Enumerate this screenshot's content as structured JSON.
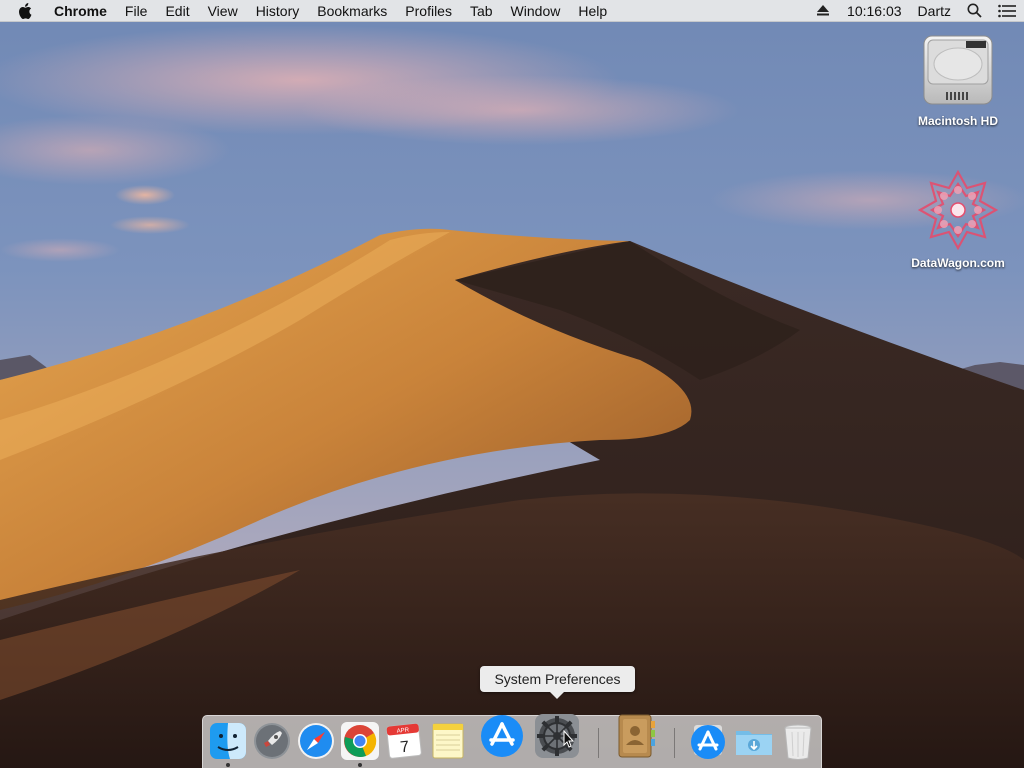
{
  "menubar": {
    "app_name": "Chrome",
    "items": [
      "File",
      "Edit",
      "View",
      "History",
      "Bookmarks",
      "Profiles",
      "Tab",
      "Window",
      "Help"
    ],
    "clock": "10:16:03",
    "user": "Dartz"
  },
  "desktop": {
    "icons": [
      {
        "label": "Macintosh HD",
        "icon": "hard-drive-icon"
      },
      {
        "label": "DataWagon.com",
        "icon": "datawagon-logo-icon"
      }
    ]
  },
  "tooltip": {
    "text": "System Preferences"
  },
  "dock": {
    "items": [
      {
        "name": "finder",
        "icon": "finder-icon",
        "running": true
      },
      {
        "name": "launchpad",
        "icon": "rocket-icon",
        "running": false
      },
      {
        "name": "safari",
        "icon": "compass-icon",
        "running": false
      },
      {
        "name": "chrome",
        "icon": "chrome-icon",
        "running": true
      },
      {
        "name": "calendar",
        "icon": "calendar-icon",
        "running": false,
        "month": "APR",
        "day": "7"
      },
      {
        "name": "notes",
        "icon": "notes-icon",
        "running": false
      },
      {
        "name": "app-store",
        "icon": "app-store-icon",
        "running": false
      },
      {
        "name": "system-preferences",
        "icon": "gear-icon",
        "running": false,
        "hovered": true
      },
      {
        "name": "contacts",
        "icon": "address-book-icon",
        "running": false
      },
      {
        "name": "applications-stack",
        "icon": "app-store-icon",
        "running": false
      },
      {
        "name": "downloads-stack",
        "icon": "downloads-folder-icon",
        "running": false
      },
      {
        "name": "trash",
        "icon": "trash-icon",
        "running": false
      }
    ]
  },
  "colors": {
    "menubar": "#ececec",
    "sky_top": "#6f86b2",
    "sky_bottom": "#b4a9b5",
    "dune_light": "#d9953f",
    "dune_shadow": "#3a2823"
  }
}
